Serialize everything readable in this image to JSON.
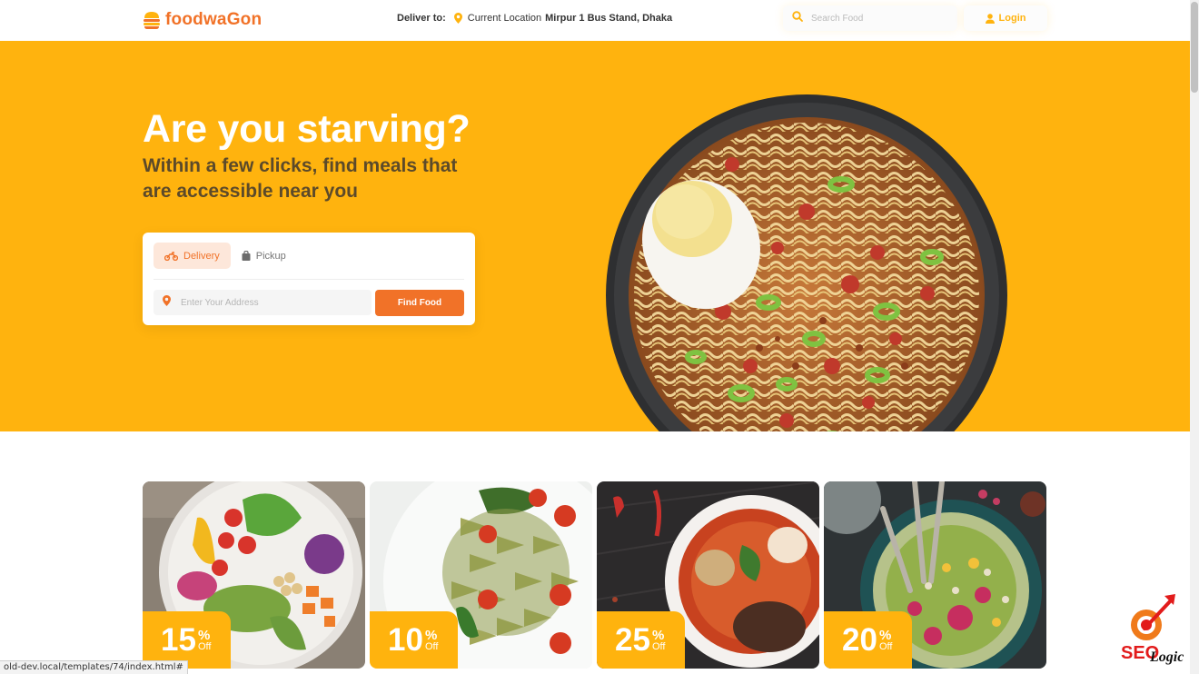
{
  "header": {
    "logo_text": "foodwaGon",
    "deliver_label": "Deliver to:",
    "current_location_label": "Current Location",
    "address": "Mirpur 1 Bus Stand, Dhaka",
    "search_placeholder": "Search Food",
    "login_label": "Login"
  },
  "hero": {
    "title": "Are you starving?",
    "subtitle": "Within a few clicks, find meals that are accessible near you",
    "tabs": [
      {
        "label": "Delivery",
        "active": true,
        "icon": "motorbike-icon"
      },
      {
        "label": "Pickup",
        "active": false,
        "icon": "shopping-bag-icon"
      }
    ],
    "address_placeholder": "Enter Your Address",
    "find_button": "Find Food",
    "image": "noodle-bowl-with-egg"
  },
  "deals": [
    {
      "percent": "15",
      "percent_sign": "%",
      "off": "Off",
      "image": "salad-bowl"
    },
    {
      "percent": "10",
      "percent_sign": "%",
      "off": "Off",
      "image": "pesto-pasta"
    },
    {
      "percent": "25",
      "percent_sign": "%",
      "off": "Off",
      "image": "curry-bowl"
    },
    {
      "percent": "20",
      "percent_sign": "%",
      "off": "Off",
      "image": "grain-bowl"
    }
  ],
  "status_bar": {
    "url": "old-dev.local/templates/74/index.html#"
  },
  "watermark": {
    "text": "SEO Logic"
  },
  "colors": {
    "primary": "#FFB30E",
    "accent": "#F17228",
    "subtitle": "#5C4A2A"
  }
}
